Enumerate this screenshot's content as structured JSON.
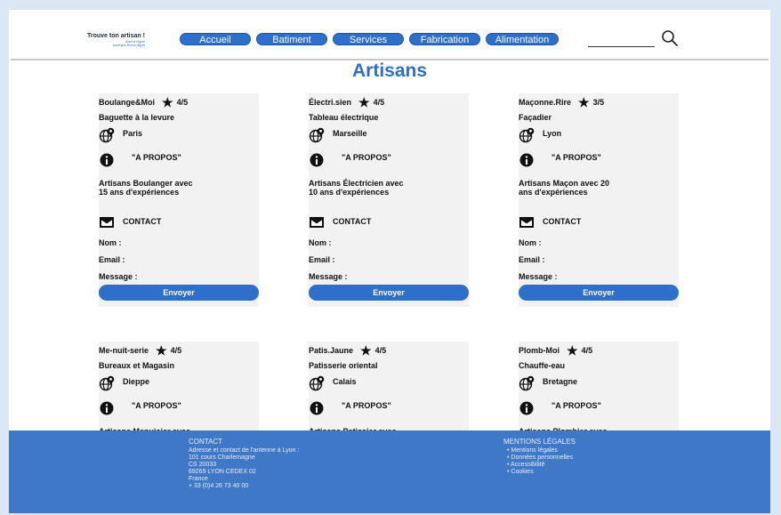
{
  "header": {
    "logo_title": "Trouve ton artisan !",
    "logo_sub1": "Avec la région",
    "logo_sub2": "Auvergne-Rhône-Alpes",
    "nav": [
      "Accueil",
      "Batiment",
      "Services",
      "Fabrication",
      "Alimentation"
    ],
    "search_icon": "search-icon"
  },
  "page_title": "Artisans",
  "labels": {
    "about": "\"A PROPOS\"",
    "contact": "CONTACT",
    "nom": "Nom :",
    "email": "Email :",
    "message": "Message :",
    "send": "Envoyer"
  },
  "cards": [
    {
      "name": "Boulange&Moi",
      "rating": "4/5",
      "specialty": "Baguette à la levure",
      "city": "Paris",
      "desc1": "Artisans Boulanger avec",
      "desc2": "15 ans d'expériences"
    },
    {
      "name": "Électri.sien",
      "rating": "4/5",
      "specialty": "Tableau électrique",
      "city": "Marseille",
      "desc1": "Artisans Électricien avec",
      "desc2": "10 ans d'expériences"
    },
    {
      "name": "Maçonne.Rire",
      "rating": "3/5",
      "specialty": "Façadier",
      "city": "Lyon",
      "desc1": "Artisans Maçon avec  20",
      "desc2": "ans d'expériences"
    },
    {
      "name": "Me-nuit-serie",
      "rating": "4/5",
      "specialty": "Bureaux et Magasin",
      "city": "Dieppe",
      "desc1": "Artisans Menuisier avec",
      "desc2": ""
    },
    {
      "name": "Patis.Jaune",
      "rating": "4/5",
      "specialty": "Patisserie oriental",
      "city": "Calais",
      "desc1": "Artisans Patissier avec",
      "desc2": ""
    },
    {
      "name": "Plomb-Moi",
      "rating": "4/5",
      "specialty": "Chauffe-eau",
      "city": "Bretagne",
      "desc1": "Artisans Plombier avec",
      "desc2": ""
    }
  ],
  "footer": {
    "contact_title": "CONTACT",
    "contact_lines": [
      "Adresse et contact de l'antenne à Lyon :",
      "101 cours Charlemagne",
      "CS 20033",
      "69269 LYON CEDEX 02",
      "France",
      "+ 33 (0)4 26 73 40 00"
    ],
    "legal_title": "MENTIONS LÉGALES",
    "legal_items": [
      "Mentions légales",
      "Données personnelles",
      "Accessibilité",
      "Cookies"
    ]
  },
  "colors": {
    "accent": "#2d6fca",
    "heading": "#2f6fc6",
    "footer": "#3f78c7",
    "background": "#dce7f5"
  }
}
